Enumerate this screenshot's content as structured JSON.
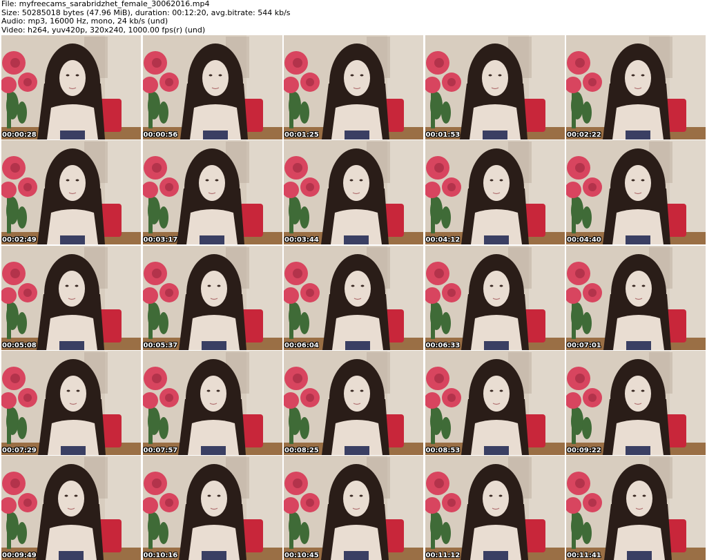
{
  "info": {
    "file": "File: myfreecams_sarabridzhet_female_30062016.mp4",
    "size": "Size: 50285018 bytes (47.96 MiB), duration: 00:12:20, avg.bitrate: 544 kb/s",
    "audio": "Audio: mp3, 16000 Hz, mono, 24 kb/s (und)",
    "video": "Video: h264, yuv420p, 320x240, 1000.00 fps(r) (und)"
  },
  "thumbnails": [
    {
      "time": "00:00:28"
    },
    {
      "time": "00:00:56"
    },
    {
      "time": "00:01:25"
    },
    {
      "time": "00:01:53"
    },
    {
      "time": "00:02:22"
    },
    {
      "time": "00:02:49"
    },
    {
      "time": "00:03:17"
    },
    {
      "time": "00:03:44"
    },
    {
      "time": "00:04:12"
    },
    {
      "time": "00:04:40"
    },
    {
      "time": "00:05:08"
    },
    {
      "time": "00:05:37"
    },
    {
      "time": "00:06:04"
    },
    {
      "time": "00:06:33"
    },
    {
      "time": "00:07:01"
    },
    {
      "time": "00:07:29"
    },
    {
      "time": "00:07:57"
    },
    {
      "time": "00:08:25"
    },
    {
      "time": "00:08:53"
    },
    {
      "time": "00:09:22"
    },
    {
      "time": "00:09:49"
    },
    {
      "time": "00:10:16"
    },
    {
      "time": "00:10:45"
    },
    {
      "time": "00:11:12"
    },
    {
      "time": "00:11:41"
    }
  ],
  "colors": {
    "wall": "#d8cdbf",
    "floor": "#9a6f45",
    "rose": "#d8455f",
    "leaf": "#3f6b37",
    "chair": "#c8263a",
    "hair": "#2a1d18",
    "skin": "#e9ddd2",
    "top": "#3a3f63"
  }
}
